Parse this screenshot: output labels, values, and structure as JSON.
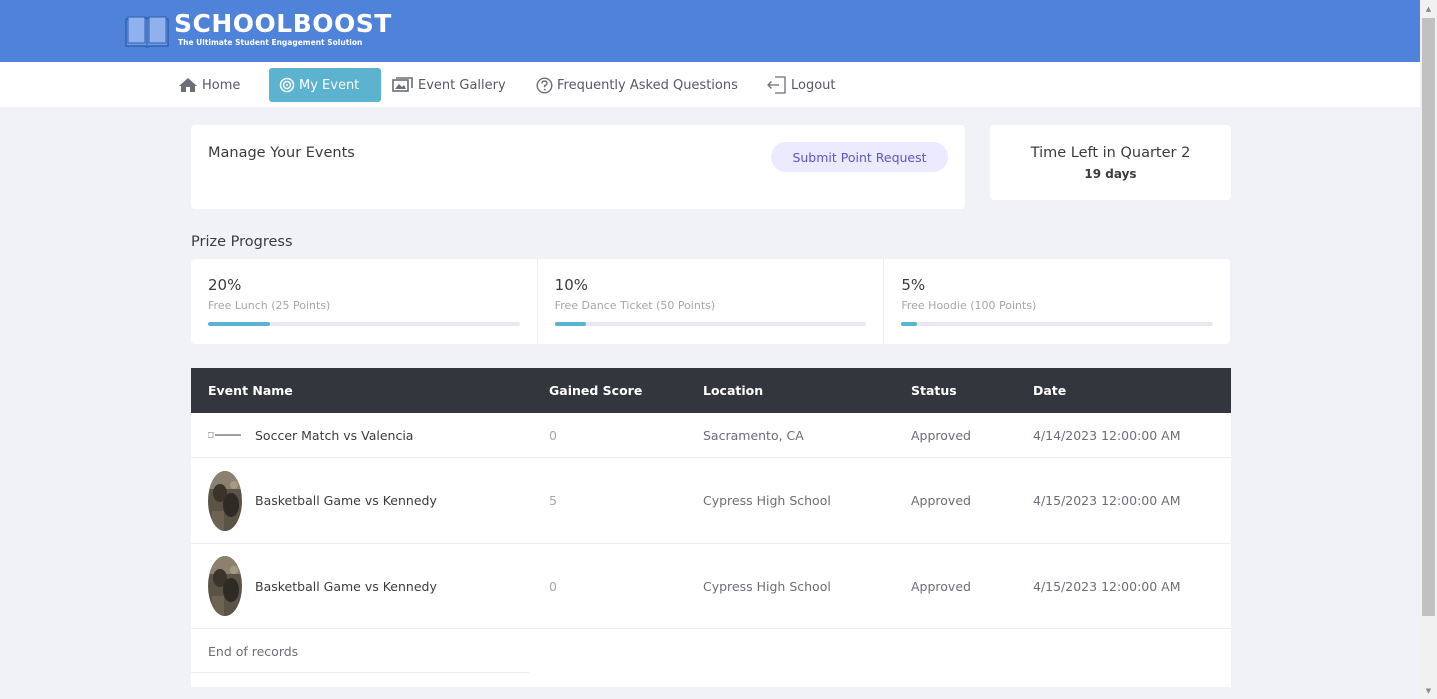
{
  "brand": {
    "name": "SCHOOLBOOST",
    "tagline": "The Ultimate Student Engagement Solution",
    "header_color": "#4f83d9"
  },
  "nav": {
    "items": [
      {
        "label": "Home",
        "icon": "home-icon"
      },
      {
        "label": "My Event",
        "icon": "target-icon",
        "active": true
      },
      {
        "label": "Event Gallery",
        "icon": "gallery-icon"
      },
      {
        "label": "Frequently Asked Questions",
        "icon": "question-circle-icon"
      },
      {
        "label": "Logout",
        "icon": "logout-icon"
      }
    ],
    "active_color": "#5bb3cf"
  },
  "manage": {
    "title": "Manage Your Events",
    "submit_label": "Submit Point Request"
  },
  "time_left": {
    "label": "Time Left in Quarter 2",
    "value": "19 days"
  },
  "prize": {
    "title": "Prize Progress",
    "items": [
      {
        "percent": "20%",
        "name": "Free Lunch (25 Points)",
        "progress": 0.2
      },
      {
        "percent": "10%",
        "name": "Free Dance Ticket (50 Points)",
        "progress": 0.1
      },
      {
        "percent": "5%",
        "name": "Free Hoodie (100 Points)",
        "progress": 0.05
      }
    ]
  },
  "events_table": {
    "headers": {
      "name": "Event Name",
      "score": "Gained Score",
      "location": "Location",
      "status": "Status",
      "date": "Date"
    },
    "rows": [
      {
        "name": "Soccer Match vs Valencia",
        "score": "0",
        "location": "Sacramento, CA",
        "status": "Approved",
        "date": "4/14/2023 12:00:00 AM",
        "thumb": "schoolboost-logo"
      },
      {
        "name": "Basketball Game vs Kennedy",
        "score": "5",
        "location": "Cypress High School",
        "status": "Approved",
        "date": "4/15/2023 12:00:00 AM",
        "thumb": "event-photo"
      },
      {
        "name": "Basketball Game vs Kennedy",
        "score": "0",
        "location": "Cypress High School",
        "status": "Approved",
        "date": "4/15/2023 12:00:00 AM",
        "thumb": "event-photo"
      }
    ],
    "footer": "End of records"
  }
}
